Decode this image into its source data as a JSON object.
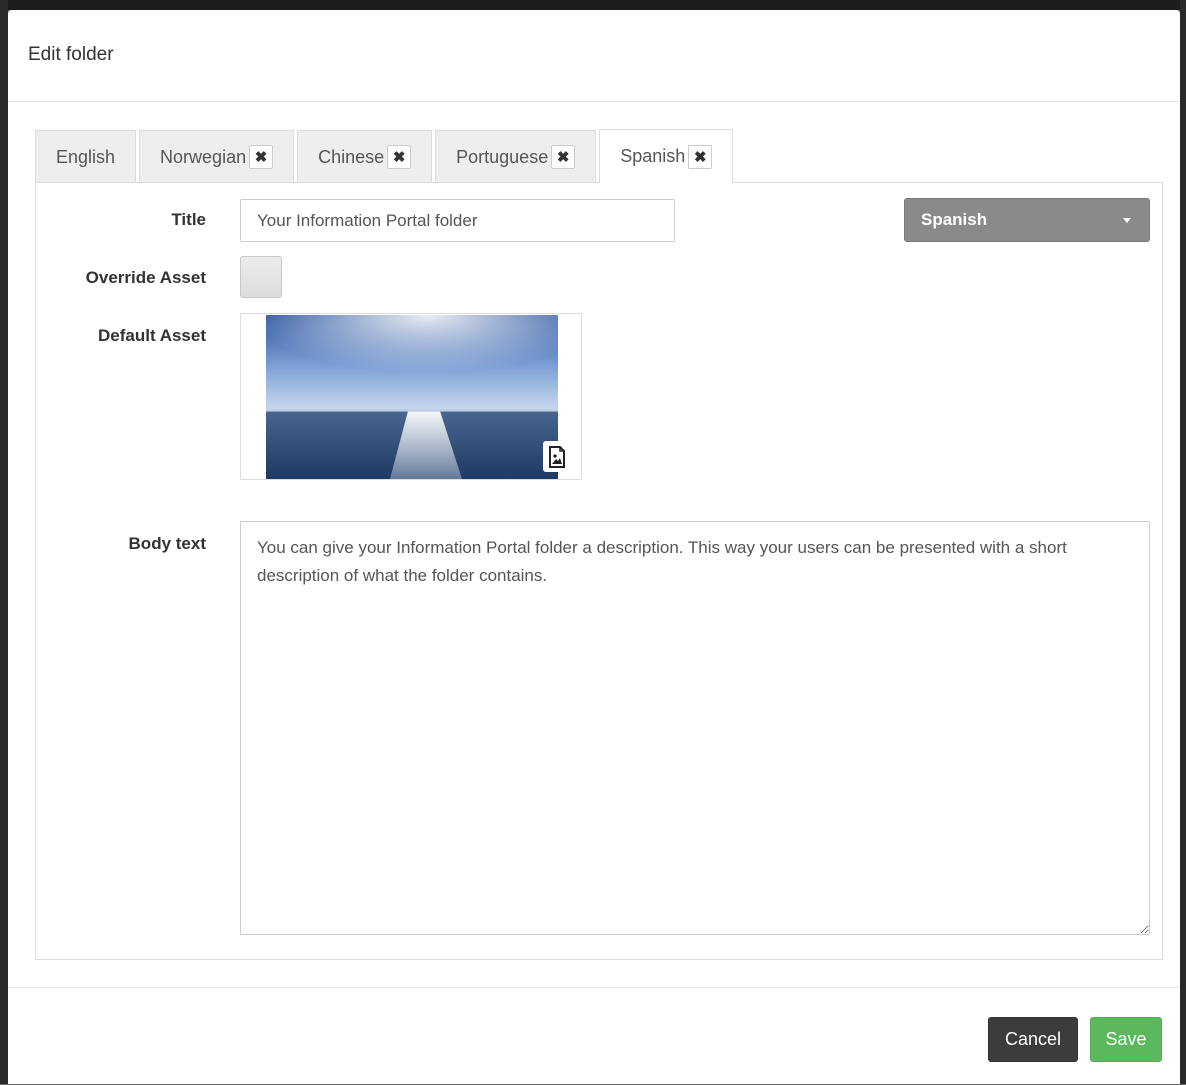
{
  "modal": {
    "title": "Edit folder"
  },
  "tabs": [
    {
      "label": "English",
      "closable": false,
      "active": false
    },
    {
      "label": "Norwegian",
      "closable": true,
      "active": false
    },
    {
      "label": "Chinese",
      "closable": true,
      "active": false
    },
    {
      "label": "Portuguese",
      "closable": true,
      "active": false
    },
    {
      "label": "Spanish",
      "closable": true,
      "active": true
    }
  ],
  "tab_close_glyph": "✖",
  "form": {
    "title_label": "Title",
    "title_value": "Your Information Portal folder",
    "language_select": "Spanish",
    "override_label": "Override Asset",
    "override_checked": false,
    "default_asset_label": "Default Asset",
    "asset_icon": "image-file-icon",
    "body_label": "Body text",
    "body_value": "You can give your Information Portal folder a description. This way your users can be presented with a short description of what the folder contains."
  },
  "footer": {
    "cancel_label": "Cancel",
    "save_label": "Save"
  },
  "colors": {
    "save": "#5cb85c",
    "cancel": "#3c3c3c",
    "select": "#8a8a8a"
  }
}
